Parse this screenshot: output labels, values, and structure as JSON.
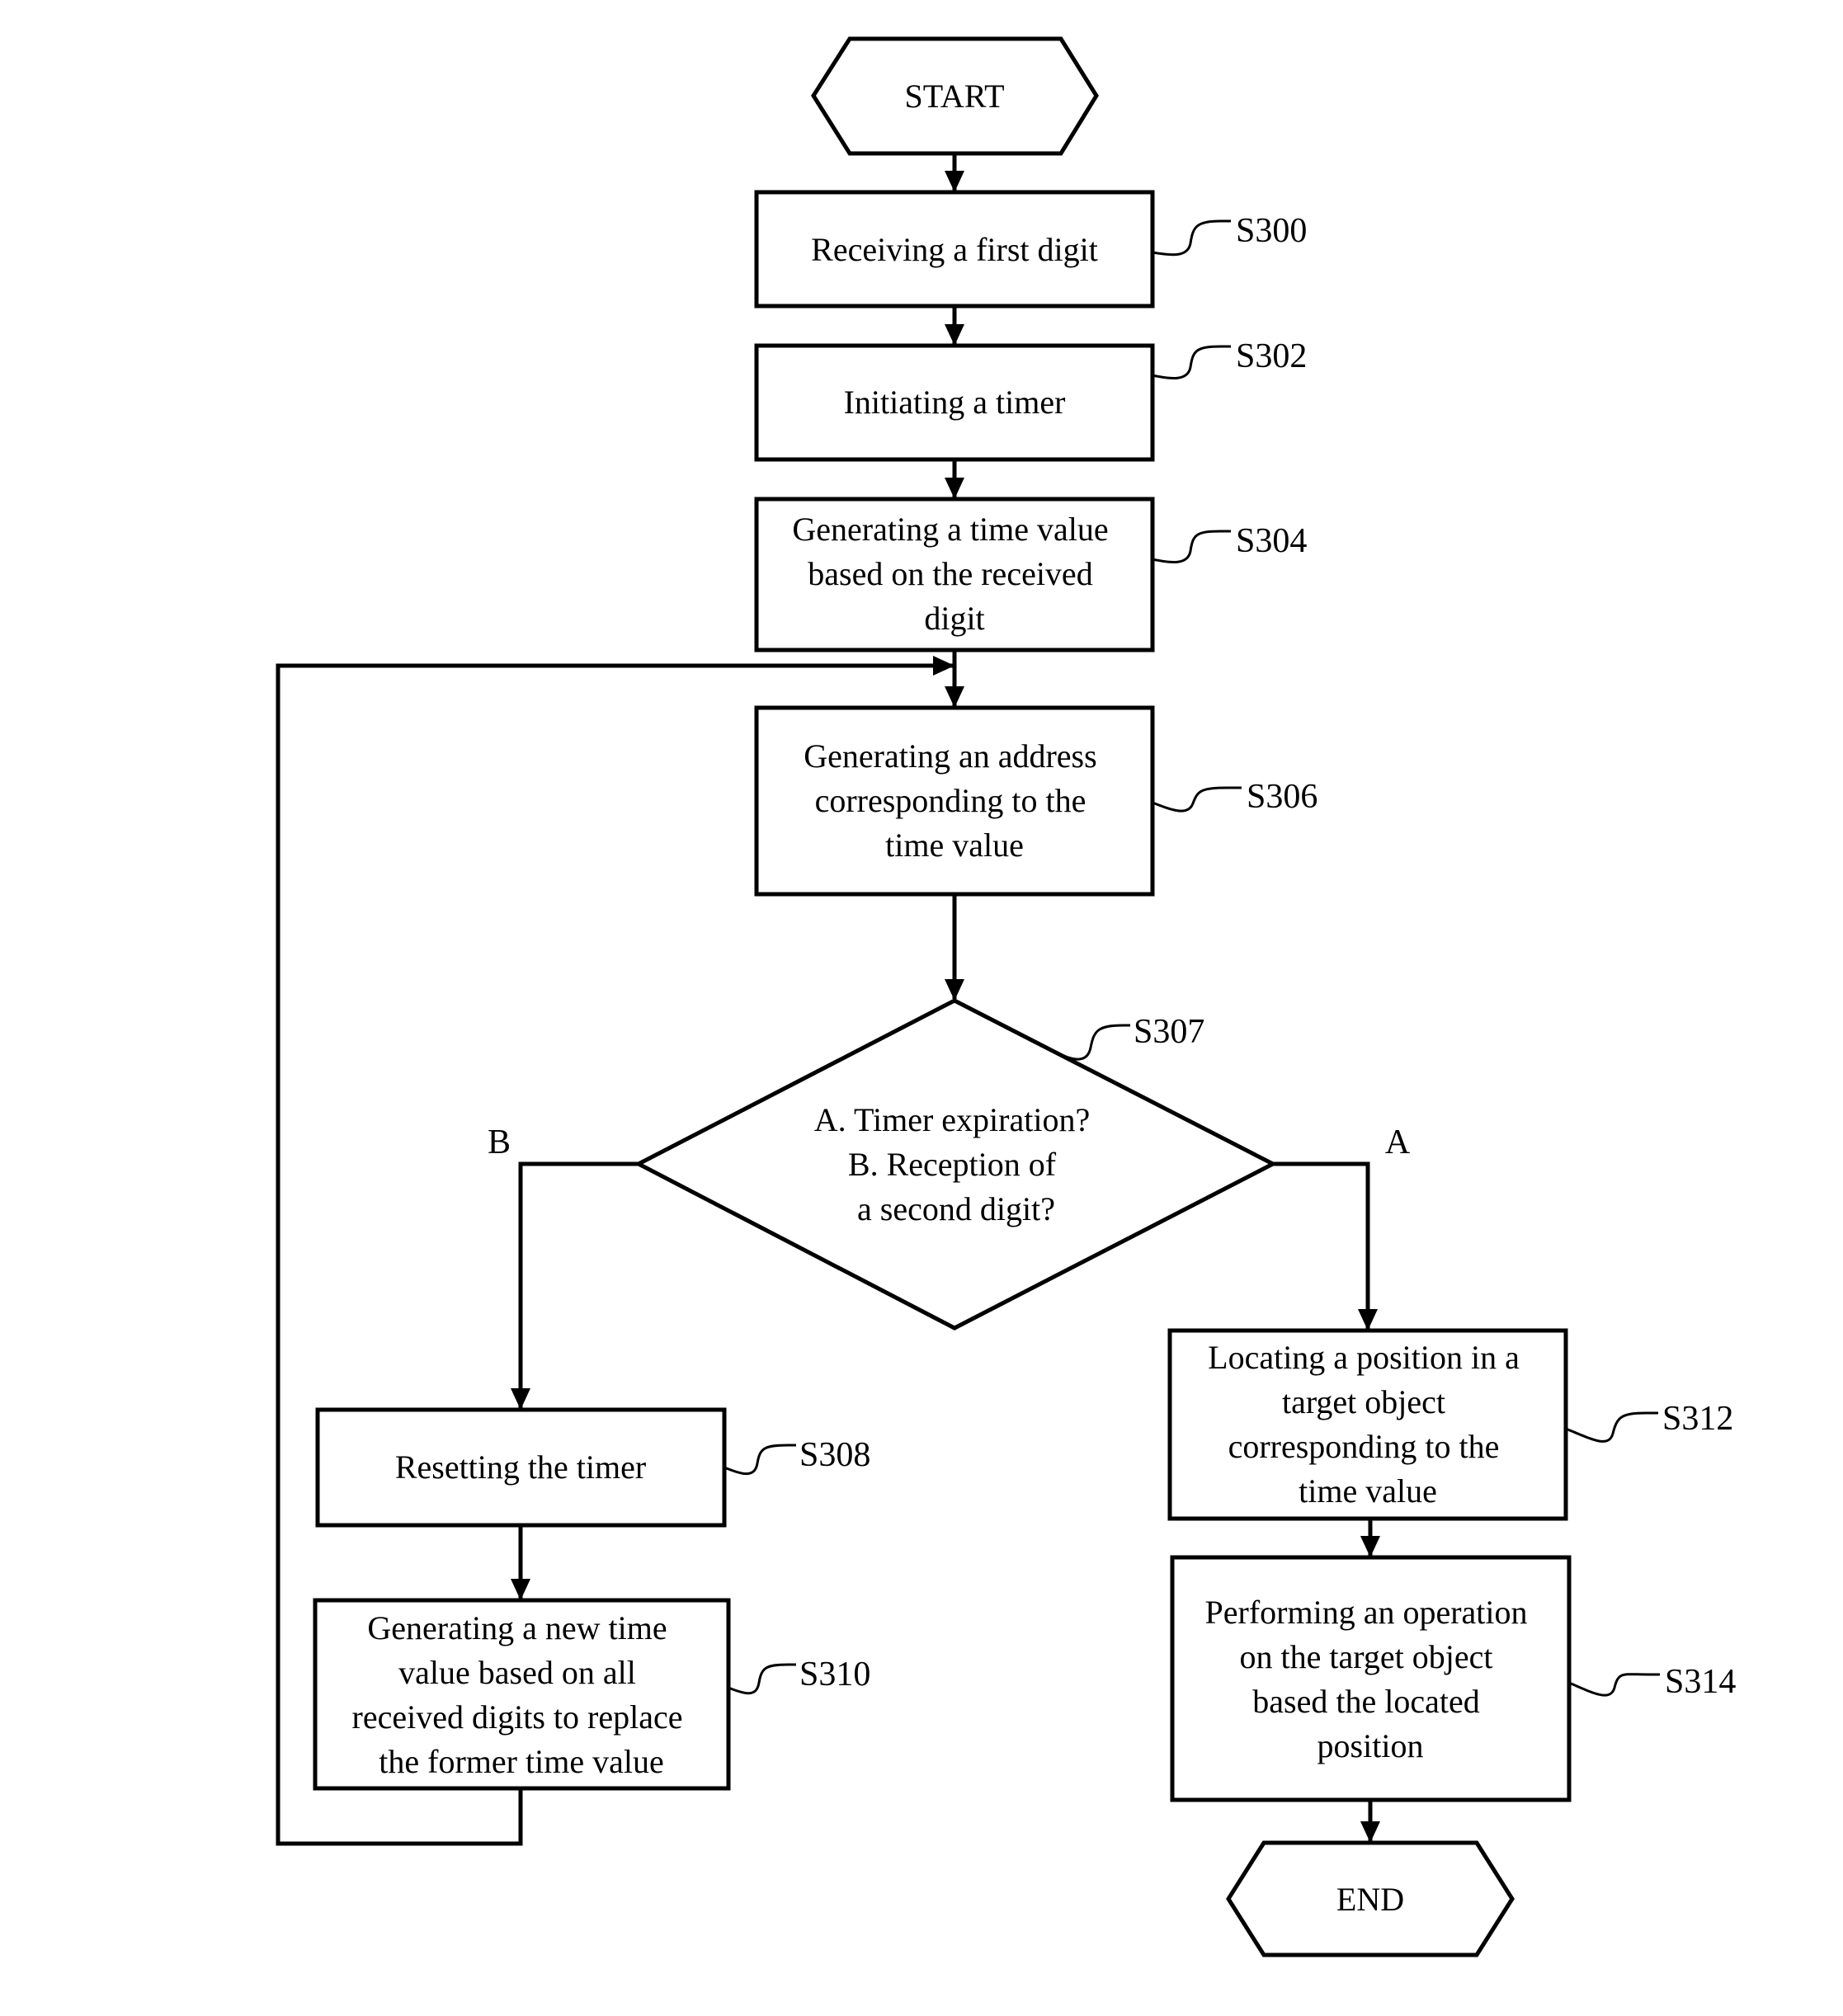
{
  "figure": {
    "start_label": "START",
    "end_label": "END",
    "steps": {
      "s300": {
        "id": "S300",
        "lines": [
          "Receiving a first digit"
        ]
      },
      "s302": {
        "id": "S302",
        "lines": [
          "Initiating a timer"
        ]
      },
      "s304": {
        "id": "S304",
        "lines": [
          "Generating a time value",
          "based on the received",
          "digit"
        ]
      },
      "s306": {
        "id": "S306",
        "lines": [
          "Generating an address",
          "corresponding to the",
          "time value"
        ]
      },
      "s307": {
        "id": "S307",
        "lines": [
          "A. Timer expiration?",
          "B. Reception of",
          "a second digit?"
        ]
      },
      "s308": {
        "id": "S308",
        "lines": [
          "Resetting the timer"
        ]
      },
      "s310": {
        "id": "S310",
        "lines": [
          "Generating a new time",
          "value based on all",
          "received digits to replace",
          "the former time value"
        ]
      },
      "s312": {
        "id": "S312",
        "lines": [
          "Locating a position in a",
          "target object",
          "corresponding to the",
          "time value"
        ]
      },
      "s314": {
        "id": "S314",
        "lines": [
          "Performing an operation",
          "on the target object",
          "based the located",
          "position"
        ]
      }
    },
    "branches": {
      "a": "A",
      "b": "B"
    }
  }
}
